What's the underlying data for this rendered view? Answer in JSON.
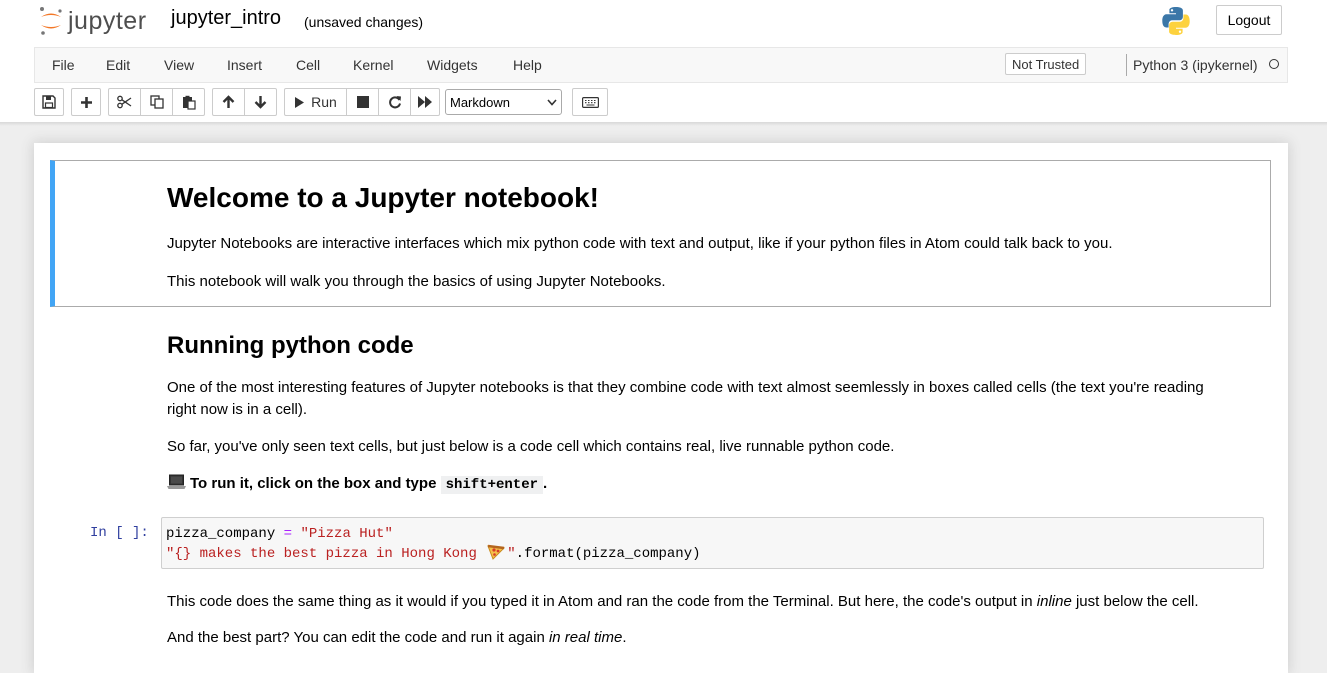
{
  "header": {
    "logo_text": "jupyter",
    "notebook_name": "jupyter_intro",
    "save_status": "(unsaved changes)",
    "logout_label": "Logout"
  },
  "menubar": {
    "items": [
      "File",
      "Edit",
      "View",
      "Insert",
      "Cell",
      "Kernel",
      "Widgets",
      "Help"
    ],
    "trusted_label": "Not Trusted",
    "kernel_name": "Python 3 (ipykernel)"
  },
  "toolbar": {
    "run_label": "Run",
    "cell_type": "Markdown",
    "icons": [
      "save-icon",
      "plus-icon",
      "cut-icon",
      "copy-icon",
      "paste-icon",
      "arrow-up-icon",
      "arrow-down-icon",
      "run-icon",
      "stop-icon",
      "restart-icon",
      "fast-forward-icon",
      "keyboard-icon"
    ]
  },
  "cells": {
    "welcome": {
      "heading": "Welcome to a Jupyter notebook!",
      "p1": "Jupyter Notebooks are interactive interfaces which mix python code with text and output, like if your python files in Atom could talk back to you.",
      "p2": "This notebook will walk you through the basics of using Jupyter Notebooks."
    },
    "running": {
      "heading": "Running python code",
      "p1a": "One of the most interesting features of Jupyter notebooks is that they combine code with text almost seemlessly in boxes called cells (the text you're reading",
      "p1b": "right now is in a cell).",
      "p2": "So far, you've only seen text cells, but just below is a code cell which contains real, live runnable python code.",
      "instruction": "To run it, click on the box and type",
      "shortcut": "shift+enter",
      "instruction_end": "."
    },
    "code": {
      "prompt": "In [ ]:",
      "line1_var": "pizza_company",
      "line1_op": " = ",
      "line1_str": "\"Pizza Hut\"",
      "line2_str_a": "\"{} makes the best pizza in Hong Kong ",
      "line2_str_b": "\"",
      "line2_rest": ".format(pizza_company)"
    },
    "after": {
      "p1a": "This code does the same thing as it would if you typed it in Atom and ran the code from the Terminal. But here, the code's output in ",
      "p1_em": "inline",
      "p1b": " just below the cell.",
      "p2a": "And the best part? You can edit the code and run it again ",
      "p2_em": "in real time",
      "p2b": "."
    }
  },
  "colors": {
    "selected_cell_border": "#42a5f5",
    "prompt": "#303f9f",
    "string": "#ba2121",
    "operator": "#aa22ff",
    "jupyter_orange": "#f37726"
  }
}
